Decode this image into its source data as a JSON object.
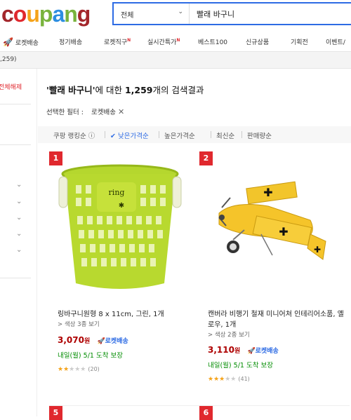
{
  "logo": "coupang",
  "search": {
    "category": "전체",
    "query": "빨래 바구니"
  },
  "nav": {
    "items": [
      {
        "label": "로켓배송",
        "badge": ""
      },
      {
        "label": "정기배송",
        "badge": ""
      },
      {
        "label": "로켓직구",
        "badge": "N"
      },
      {
        "label": "실시간특가",
        "badge": "N"
      },
      {
        "label": "베스트100",
        "badge": ""
      },
      {
        "label": "신규상품",
        "badge": ""
      },
      {
        "label": "기획전",
        "badge": ""
      },
      {
        "label": "이벤트/",
        "badge": ""
      }
    ]
  },
  "strip": {
    "count": ",259)"
  },
  "sidebar": {
    "reset": "전체해제"
  },
  "result": {
    "query": "빨래 바구니",
    "mid": "에 대한 ",
    "count": "1,259",
    "tail": "개의 검색결과"
  },
  "filter": {
    "label": "선택한 필터 :",
    "chip": "로켓배송"
  },
  "sort": {
    "items": [
      "쿠팡 랭킹순",
      "낮은가격순",
      "높은가격순",
      "최신순",
      "판매량순"
    ],
    "active": "낮은가격순"
  },
  "products": [
    {
      "rank": "1",
      "name": "링바구니원형 8 x 11cm, 그린, 1개",
      "options": "> 색상 3종 보기",
      "price": "3,070",
      "won": "원",
      "rocket": "로켓배송",
      "delivery": "내일(월) 5/1 도착 보장",
      "rating": 2.5,
      "reviews": "(20)",
      "image": "green-basket"
    },
    {
      "rank": "2",
      "name": "캔버라 비행기 철재 미니어쳐 인테리어소품, 옐로우, 1개",
      "options": "> 색상 2종 보기",
      "price": "3,110",
      "won": "원",
      "rocket": "로켓배송",
      "delivery": "내일(월) 5/1 도착 보장",
      "rating": 3.5,
      "reviews": "(41)",
      "image": "yellow-airplane"
    }
  ],
  "next_ranks": [
    "5",
    "6"
  ],
  "colors": {
    "accent": "#2d6be4",
    "red": "#e0282e",
    "price": "#ae0000",
    "delivery": "#008c00"
  }
}
